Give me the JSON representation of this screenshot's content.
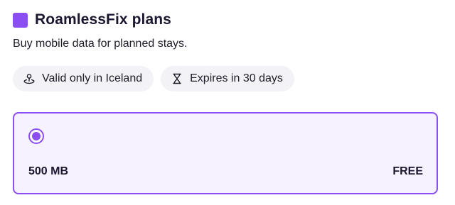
{
  "header": {
    "title": "RoamlessFix plans",
    "subtitle": "Buy mobile data for planned stays."
  },
  "chips": [
    {
      "label": "Valid only in Iceland",
      "icon": "location-pin-icon"
    },
    {
      "label": "Expires in 30 days",
      "icon": "hourglass-icon"
    }
  ],
  "plans": [
    {
      "size": "500 MB",
      "price": "FREE",
      "selected": true
    }
  ],
  "colors": {
    "accent": "#8b4ef2",
    "card_background": "#f6f2ff",
    "chip_background": "#f3f2f6",
    "text": "#1c1630"
  }
}
